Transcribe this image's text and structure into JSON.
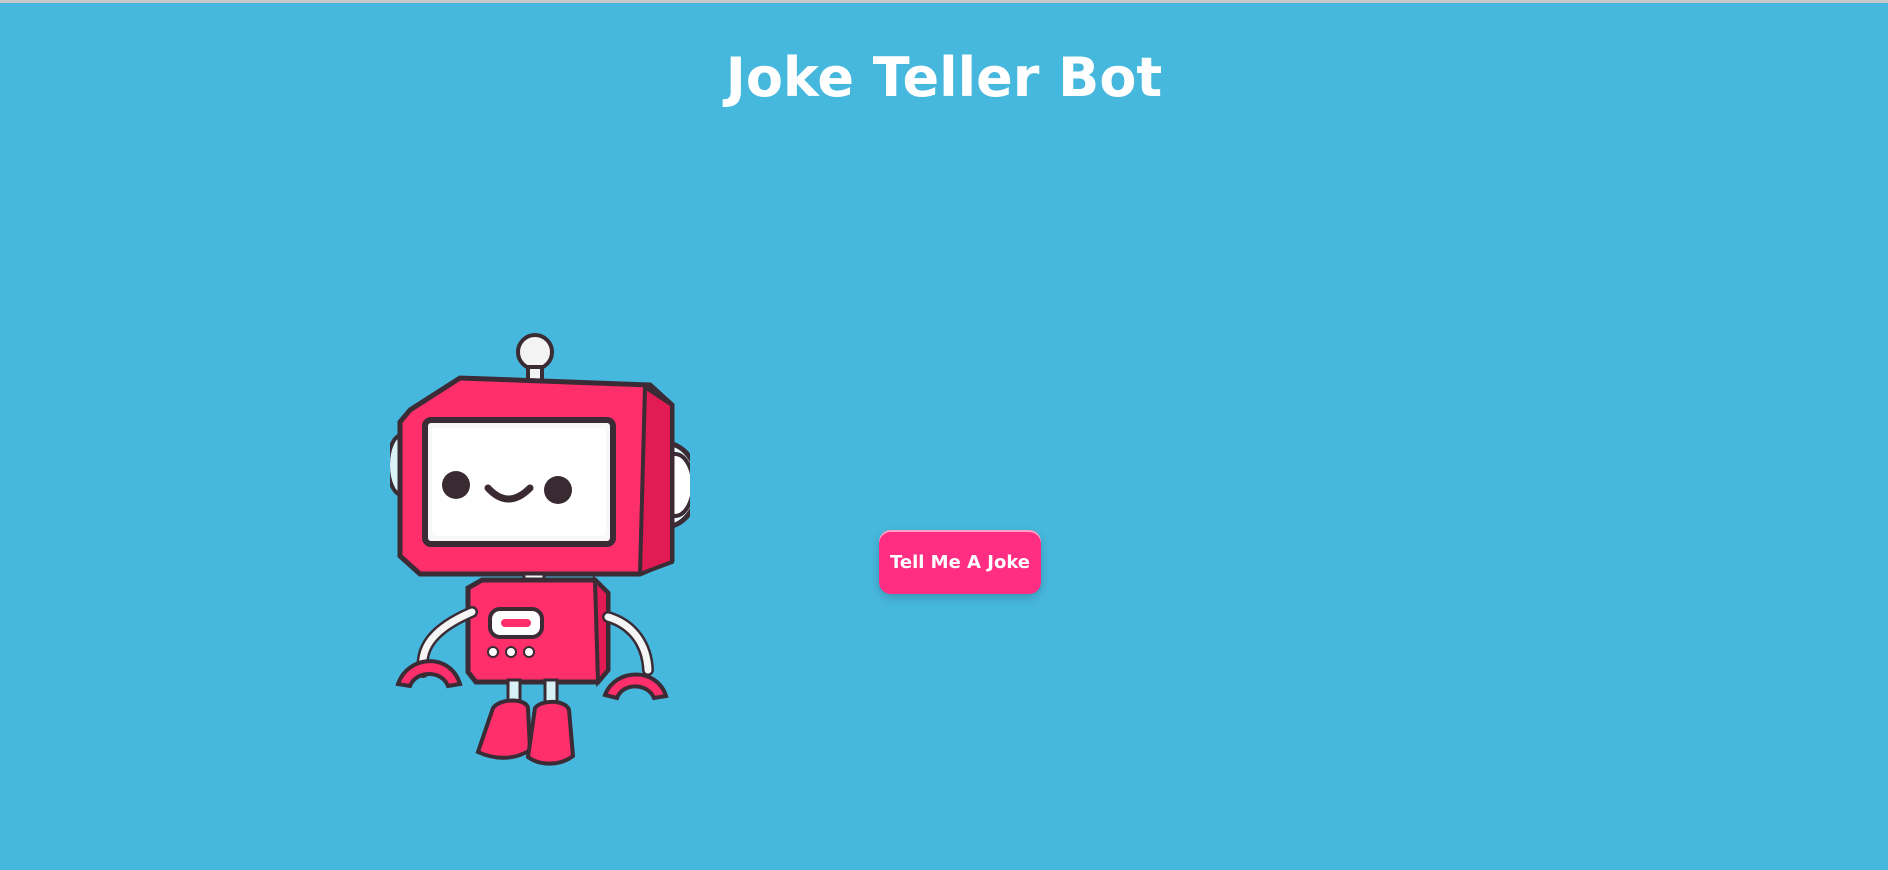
{
  "page": {
    "title": "Joke Teller Bot"
  },
  "actions": {
    "joke_button_label": "Tell Me A Joke"
  },
  "robot": {
    "icon": "robot-mascot"
  },
  "colors": {
    "background": "#47b8dd",
    "button": "#ff2e82",
    "robot_primary": "#ff2f6b",
    "robot_outline": "#3b2b35",
    "robot_screen": "#ffffff"
  }
}
